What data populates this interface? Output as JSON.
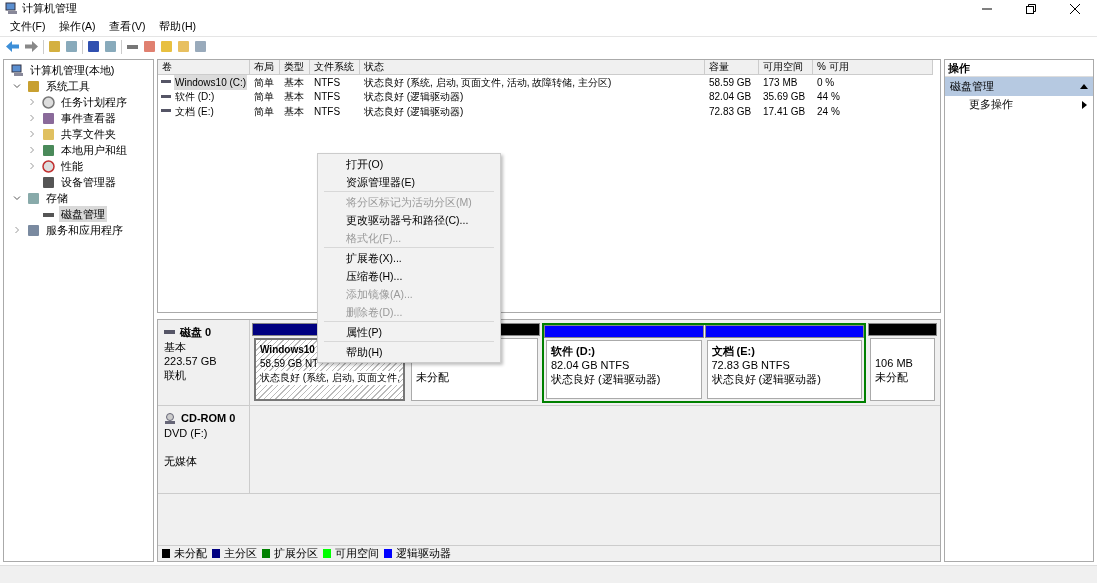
{
  "window": {
    "title": "计算机管理"
  },
  "menu_bar": [
    "文件(F)",
    "操作(A)",
    "查看(V)",
    "帮助(H)"
  ],
  "tree": [
    {
      "label": "计算机管理(本地)",
      "selected": false,
      "children": [
        {
          "label": "系统工具",
          "expanded": true,
          "selected": false,
          "children": [
            {
              "label": "任务计划程序",
              "expanded": false,
              "selected": false
            },
            {
              "label": "事件查看器",
              "expanded": false,
              "selected": false
            },
            {
              "label": "共享文件夹",
              "expanded": false,
              "selected": false
            },
            {
              "label": "本地用户和组",
              "expanded": false,
              "selected": false
            },
            {
              "label": "性能",
              "expanded": false,
              "selected": false
            },
            {
              "label": "设备管理器",
              "selected": false
            }
          ]
        },
        {
          "label": "存储",
          "expanded": true,
          "selected": false,
          "children": [
            {
              "label": "磁盘管理",
              "selected": true
            }
          ]
        },
        {
          "label": "服务和应用程序",
          "expanded": false,
          "selected": false
        }
      ]
    }
  ],
  "volumes": {
    "columns": [
      "卷",
      "布局",
      "类型",
      "文件系统",
      "状态",
      "容量",
      "可用空间",
      "% 可用"
    ],
    "rows": [
      {
        "selected": true,
        "cells": [
          "Windows10 (C:)",
          "简单",
          "基本",
          "NTFS",
          "状态良好 (系统, 启动, 页面文件, 活动, 故障转储, 主分区)",
          "58.59 GB",
          "173 MB",
          "0 %"
        ]
      },
      {
        "selected": false,
        "cells": [
          "软件 (D:)",
          "简单",
          "基本",
          "NTFS",
          "状态良好 (逻辑驱动器)",
          "82.04 GB",
          "35.69 GB",
          "44 %"
        ]
      },
      {
        "selected": false,
        "cells": [
          "文档 (E:)",
          "简单",
          "基本",
          "NTFS",
          "状态良好 (逻辑驱动器)",
          "72.83 GB",
          "17.41 GB",
          "24 %"
        ]
      }
    ]
  },
  "disks": [
    {
      "kind": "disk",
      "name": "磁盘 0",
      "lines": [
        "基本",
        "223.57 GB",
        "联机"
      ],
      "partitions": [
        {
          "kind": "primary",
          "color": "#000080",
          "selected": true,
          "name": "Windows10",
          "size": "58.59 GB NT",
          "status": "状态良好 (系统, 启动, 页面文件,"
        },
        {
          "kind": "unallocated",
          "color": "#000000",
          "selected": false,
          "status": "未分配"
        },
        {
          "kind": "extended",
          "color": "#008000",
          "children": [
            {
              "kind": "logical",
              "color": "#0000ff",
              "selected": false,
              "name": "软件  (D:)",
              "size": "82.04 GB NTFS",
              "status": "状态良好 (逻辑驱动器)"
            },
            {
              "kind": "logical",
              "color": "#0000ff",
              "selected": false,
              "name": "文档  (E:)",
              "size": "72.83 GB NTFS",
              "status": "状态良好 (逻辑驱动器)"
            }
          ]
        },
        {
          "kind": "unallocated",
          "color": "#000000",
          "selected": false,
          "size": "106 MB",
          "status": "未分配"
        }
      ]
    },
    {
      "kind": "cdrom",
      "name": "CD-ROM 0",
      "lines": [
        "DVD (F:)",
        "无媒体"
      ]
    }
  ],
  "legend": [
    {
      "label": "未分配",
      "color": "#000000"
    },
    {
      "label": "主分区",
      "color": "#000080"
    },
    {
      "label": "扩展分区",
      "color": "#008000"
    },
    {
      "label": "可用空间",
      "color": "#00ff00"
    },
    {
      "label": "逻辑驱动器",
      "color": "#0000ff"
    }
  ],
  "actions": {
    "title": "操作",
    "sections": [
      {
        "label": "磁盘管理",
        "expanded": true,
        "items": [
          "更多操作"
        ]
      }
    ]
  },
  "context_menu": {
    "groups": [
      [
        {
          "label": "打开(O)",
          "disabled": false
        },
        {
          "label": "资源管理器(E)",
          "disabled": false
        }
      ],
      [
        {
          "label": "将分区标记为活动分区(M)",
          "disabled": true
        },
        {
          "label": "更改驱动器号和路径(C)...",
          "disabled": false
        },
        {
          "label": "格式化(F)...",
          "disabled": true
        }
      ],
      [
        {
          "label": "扩展卷(X)...",
          "disabled": false
        },
        {
          "label": "压缩卷(H)...",
          "disabled": false
        },
        {
          "label": "添加镜像(A)...",
          "disabled": true
        },
        {
          "label": "删除卷(D)...",
          "disabled": true
        }
      ],
      [
        {
          "label": "属性(P)",
          "disabled": false
        }
      ],
      [
        {
          "label": "帮助(H)",
          "disabled": false
        }
      ]
    ]
  }
}
